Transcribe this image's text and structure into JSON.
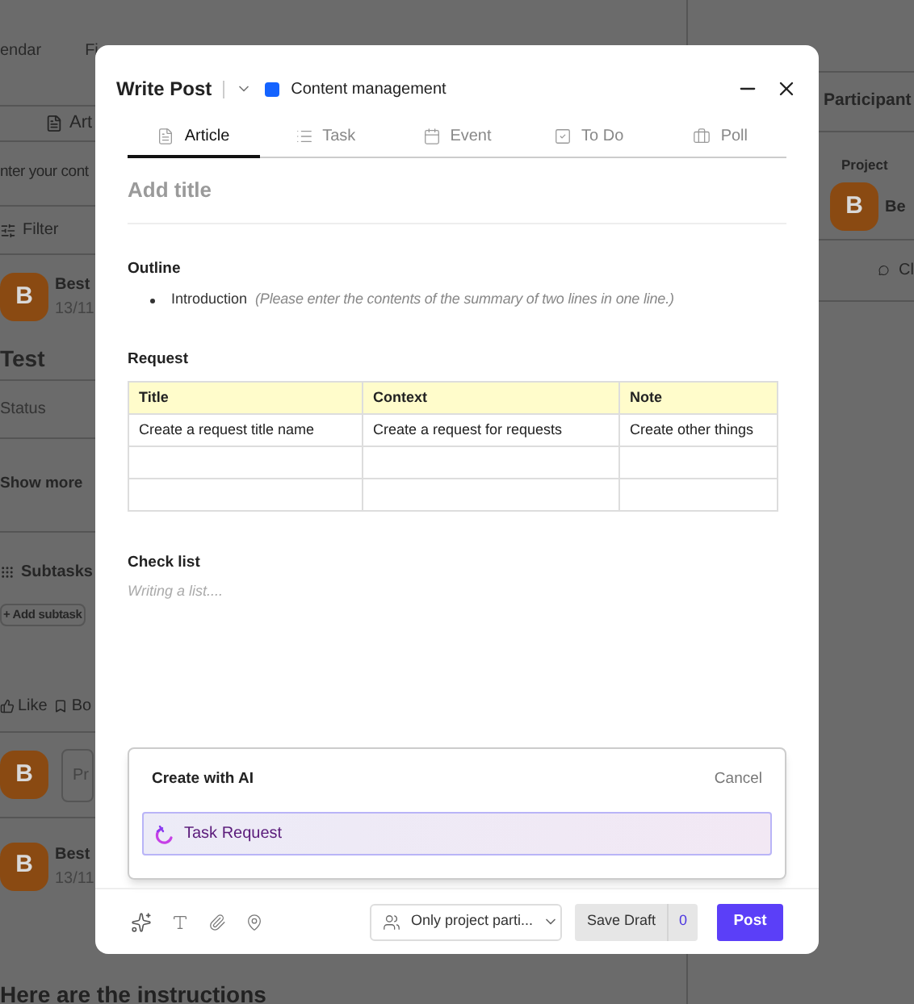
{
  "background": {
    "top_tabs": [
      "endar",
      "Fi"
    ],
    "left": {
      "tab": "Art",
      "input_placeholder": "nter your cont",
      "filter": "Filter",
      "post_author": {
        "avatar": "B",
        "name": "Best",
        "date": "13/11"
      },
      "title": "Test",
      "status_label": "Status",
      "show_more": "Show more",
      "subtasks": "Subtasks",
      "add_subtask": "+ Add subtask",
      "actions": [
        "Like",
        "Bo"
      ],
      "comment": {
        "avatar": "B",
        "placeholder": "Pr"
      },
      "post_author_2": {
        "avatar": "B",
        "name": "Best",
        "date": "13/11"
      },
      "body": "Here are the instructions"
    },
    "right": {
      "title": "Participant",
      "section": "Project",
      "member": {
        "avatar": "B",
        "name": "Be"
      },
      "chat": "Cl"
    }
  },
  "dialog": {
    "title": "Write Post",
    "project": {
      "name": "Content management",
      "color": "#1463ff"
    },
    "tabs": [
      {
        "label": "Article",
        "selected": true
      },
      {
        "label": "Task",
        "selected": false
      },
      {
        "label": "Event",
        "selected": false
      },
      {
        "label": "To Do",
        "selected": false
      },
      {
        "label": "Poll",
        "selected": false
      }
    ],
    "title_placeholder": "Add title",
    "outline": {
      "heading": "Outline",
      "items": [
        {
          "label": "Introduction",
          "hint": "(Please enter the contents of the summary of two lines in one line.)"
        }
      ]
    },
    "request": {
      "heading": "Request",
      "columns": [
        "Title",
        "Context",
        "Note"
      ],
      "rows": [
        [
          "Create a request title name",
          "Create a request for requests",
          "Create other things"
        ],
        [
          "",
          "",
          ""
        ],
        [
          "",
          "",
          ""
        ]
      ]
    },
    "checklist": {
      "heading": "Check list",
      "placeholder": "Writing a list...."
    },
    "ai_panel": {
      "title": "Create with AI",
      "cancel": "Cancel",
      "suggestion": "Task Request"
    },
    "footer": {
      "visibility": "Only project parti...",
      "save_draft": "Save Draft",
      "draft_count": "0",
      "post": "Post"
    }
  }
}
